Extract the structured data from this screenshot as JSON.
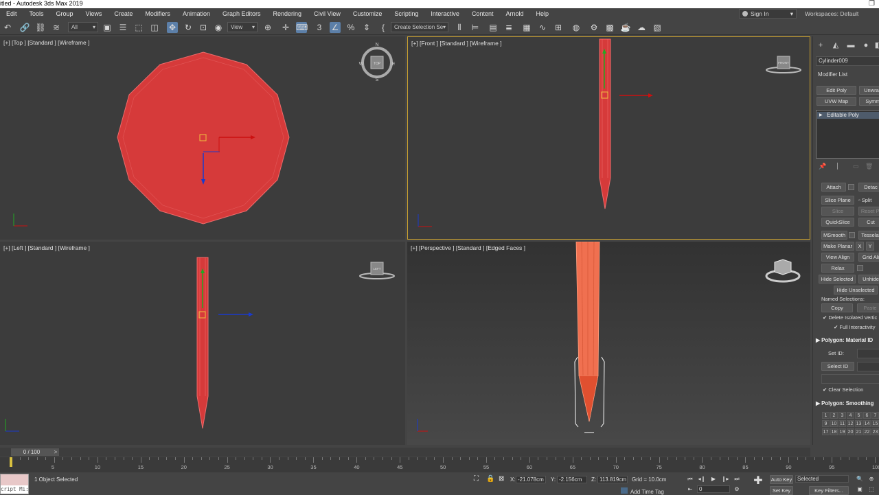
{
  "app": {
    "title": "itled - Autodesk 3ds Max 2019"
  },
  "menu": [
    "Edit",
    "Tools",
    "Group",
    "Views",
    "Create",
    "Modifiers",
    "Animation",
    "Graph Editors",
    "Rendering",
    "Civil View",
    "Customize",
    "Scripting",
    "Interactive",
    "Content",
    "Arnold",
    "Help"
  ],
  "account": {
    "signin": "Sign In",
    "workspaces_label": "Workspaces:",
    "workspace": "Default"
  },
  "toolbar": {
    "filter": "All",
    "refcoord": "View",
    "selection_set": "Create Selection Se"
  },
  "viewports": {
    "top": {
      "label": "[+] [Top ] [Standard ] [Wireframe ]",
      "cube_label": "TOP",
      "compass": {
        "n": "N",
        "s": "S",
        "e": "E",
        "w": "W"
      },
      "axis_x": "x",
      "axis_y": "y"
    },
    "front": {
      "label": "[+] [Front ] [Standard ] [Wireframe ]",
      "cube_label": "FRONT",
      "axis_x": "x",
      "axis_y": "y"
    },
    "left": {
      "label": "[+] [Left ] [Standard ] [Wireframe ]",
      "cube_label": "LEFT",
      "axis_x": "x",
      "axis_y": "y"
    },
    "persp": {
      "label": "[+] [Perspective ] [Standard ] [Edged Faces ]"
    }
  },
  "command_panel": {
    "object_name": "Cylinder009",
    "modifier_list": "Modifier List",
    "mod_buttons": [
      "Edit Poly",
      "Unwrap",
      "UVW Map",
      "Symm"
    ],
    "stack_item": "Editable Poly",
    "geometry": {
      "attach": "Attach",
      "detach": "Detac",
      "slice_plane": "Slice Plane",
      "split": "Split",
      "slice": "Slice",
      "reset_plane": "Reset Pl",
      "quickslice": "QuickSlice",
      "cut": "Cut",
      "msmooth": "MSmooth",
      "tessellate": "Tesselat",
      "make_planar": "Make Planar",
      "x": "X",
      "y": "Y",
      "view_align": "View Align",
      "grid_align": "Grid Ali",
      "relax": "Relax",
      "hide_selected": "Hide Selected",
      "unhide": "Unhide",
      "hide_unselected": "Hide Unselected",
      "named_selections": "Named Selections:",
      "copy": "Copy",
      "paste": "Paste",
      "delete_isolated": "Delete Isolated Vertic",
      "full_interactivity": "Full Interactivity"
    },
    "material": {
      "title": "Polygon: Material ID",
      "set_id": "Set ID:",
      "select_id": "Select ID",
      "clear_selection": "Clear Selection"
    },
    "smoothing": {
      "title": "Polygon: Smoothing",
      "groups": [
        "1",
        "2",
        "3",
        "4",
        "5",
        "6",
        "7",
        "8",
        "9",
        "10",
        "11",
        "12",
        "13",
        "14",
        "15",
        "16",
        "17",
        "18",
        "19",
        "20",
        "21",
        "22",
        "23",
        "24",
        "25",
        "26",
        "27",
        "28",
        "29",
        "30",
        "31",
        "32"
      ]
    }
  },
  "timeline": {
    "frame": "0 / 100",
    "next": ">",
    "ticks": [
      "0",
      "5",
      "10",
      "15",
      "20",
      "25",
      "30",
      "35",
      "40",
      "45",
      "50",
      "55",
      "60",
      "65",
      "70",
      "75",
      "80",
      "85",
      "90",
      "95",
      "100"
    ]
  },
  "status": {
    "maxscript": "cript Mi:",
    "selected": "1 Object Selected",
    "x_label": "X:",
    "x": "-21.078cm",
    "y_label": "Y:",
    "y": "-2.156cm",
    "z_label": "Z:",
    "z": "113.819cm",
    "grid": "Grid = 10.0cm",
    "add_time_tag": "Add Time Tag",
    "auto_key": "Auto Key",
    "set_key": "Set Key",
    "key_mode": "Selected",
    "key_filters": "Key Filters...",
    "current_frame": "0"
  },
  "colors": {
    "object": "#d63a3a",
    "object_edge": "#ee6b6b",
    "active_border": "#c8a030",
    "axis_x": "#cc1010",
    "axis_y": "#22aa22",
    "axis_z": "#1a3acc"
  }
}
